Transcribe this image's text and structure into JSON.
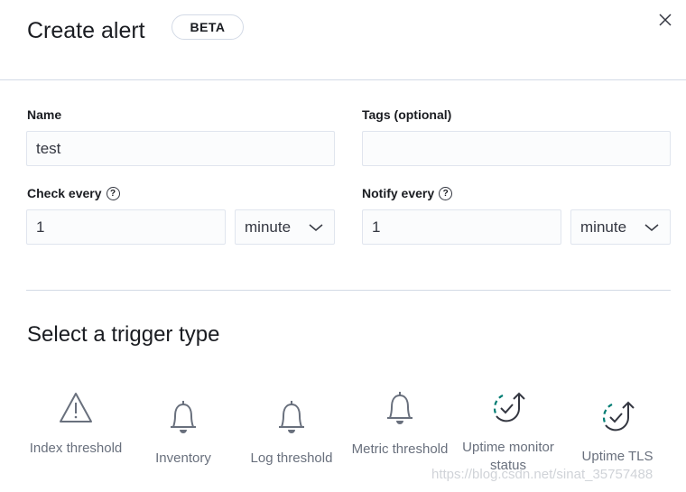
{
  "header": {
    "title": "Create alert",
    "badge": "BETA"
  },
  "form": {
    "name": {
      "label": "Name",
      "value": "test"
    },
    "tags": {
      "label": "Tags (optional)",
      "value": ""
    },
    "check_every": {
      "label": "Check every",
      "value": "1",
      "unit": "minute"
    },
    "notify_every": {
      "label": "Notify every",
      "value": "1",
      "unit": "minute"
    }
  },
  "trigger_section": {
    "title": "Select a trigger type",
    "items": [
      {
        "label": "Index threshold",
        "icon": "alert-triangle-icon"
      },
      {
        "label": "Inventory",
        "icon": "bell-icon"
      },
      {
        "label": "Log threshold",
        "icon": "bell-icon"
      },
      {
        "label": "Metric threshold",
        "icon": "bell-icon"
      },
      {
        "label": "Uptime monitor status",
        "icon": "uptime-check-icon"
      },
      {
        "label": "Uptime TLS",
        "icon": "uptime-check-icon"
      }
    ]
  },
  "colors": {
    "accent": "#017d73",
    "icon": "#69707d",
    "text": "#1a1c21"
  },
  "watermark": "https://blog.csdn.net/sinat_35757488"
}
